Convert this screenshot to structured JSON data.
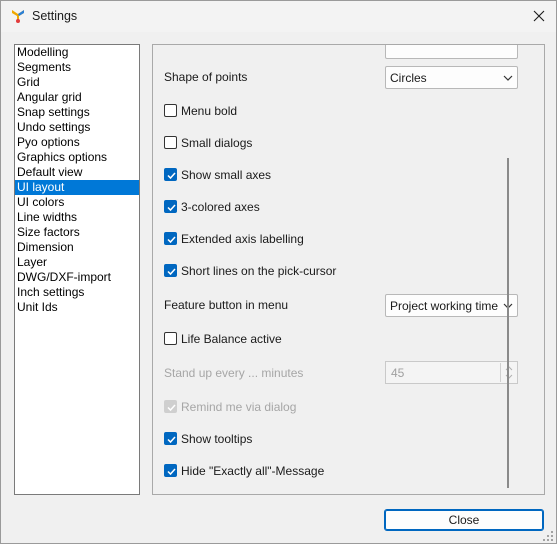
{
  "window": {
    "title": "Settings"
  },
  "categories": [
    "Modelling",
    "Segments",
    "Grid",
    "Angular grid",
    "Snap settings",
    "Undo settings",
    "Pyo options",
    "Graphics options",
    "Default view",
    "UI layout",
    "UI colors",
    "Line widths",
    "Size factors",
    "Dimension",
    "Layer",
    "DWG/DXF-import",
    "Inch settings",
    "Unit Ids"
  ],
  "selected_category": "UI layout",
  "panel": {
    "shape_of_points_label": "Shape of points",
    "shape_of_points_value": "Circles",
    "menu_bold": "Menu bold",
    "small_dialogs": "Small dialogs",
    "show_small_axes": "Show small axes",
    "three_colored_axes": "3-colored axes",
    "extended_axis_labelling": "Extended axis labelling",
    "short_lines_pick_cursor": "Short lines on the pick-cursor",
    "feature_button_label": "Feature button in menu",
    "feature_button_value": "Project working time",
    "life_balance_active": "Life Balance active",
    "stand_up_label": "Stand up every ... minutes",
    "stand_up_value": "45",
    "remind_via_dialog": "Remind me via dialog",
    "show_tooltips": "Show tooltips",
    "hide_exactly_all": "Hide \"Exactly all\"-Message"
  },
  "buttons": {
    "close": "Close"
  },
  "colors": {
    "accent": "#0078d7",
    "check": "#0067c0"
  }
}
